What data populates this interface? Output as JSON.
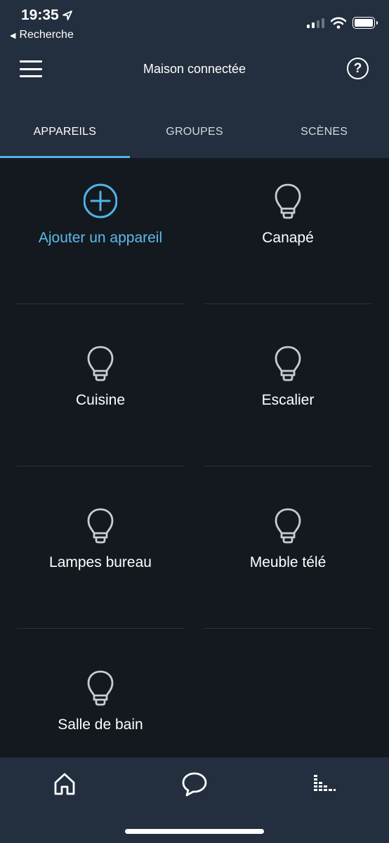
{
  "status_bar": {
    "time": "19:35",
    "back_label": "Recherche"
  },
  "header": {
    "title": "Maison connectée"
  },
  "tabs": [
    {
      "label": "APPAREILS",
      "active": true
    },
    {
      "label": "GROUPES",
      "active": false
    },
    {
      "label": "SCÈNES",
      "active": false
    }
  ],
  "devices": {
    "add_label": "Ajouter un appareil",
    "items": [
      {
        "label": "Canapé",
        "icon": "light-bulb-icon"
      },
      {
        "label": "Cuisine",
        "icon": "light-bulb-icon"
      },
      {
        "label": "Escalier",
        "icon": "light-bulb-icon"
      },
      {
        "label": "Lampes bureau",
        "icon": "light-bulb-icon"
      },
      {
        "label": "Meuble télé",
        "icon": "light-bulb-icon"
      },
      {
        "label": "Salle de bain",
        "icon": "light-bulb-icon"
      }
    ]
  },
  "bottom_nav": [
    {
      "icon": "home-icon"
    },
    {
      "icon": "chat-icon"
    },
    {
      "icon": "activity-icon"
    }
  ],
  "colors": {
    "background": "#141920",
    "header": "#232f3e",
    "accent": "#4fb5e6",
    "add_text": "#5cbbeb"
  }
}
